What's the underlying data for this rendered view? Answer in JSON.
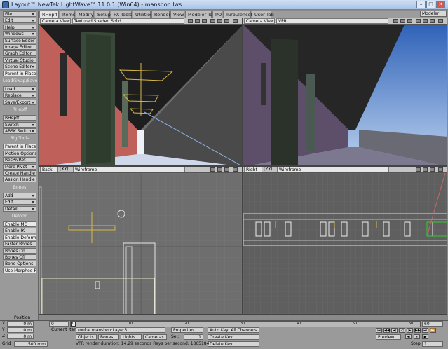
{
  "title": "Layout™ NewTek LightWave™ 11.0.1 (Win64) - manshon.lws",
  "tabs": [
    "RHepff",
    "Items",
    "Modify",
    "Setup",
    "FX Tools",
    "Utilities",
    "Render",
    "View",
    "Modeler Tools",
    "I/O",
    "TurbulenceFD",
    "User Tab"
  ],
  "modeler": "Modeler",
  "sidebar": {
    "items": [
      {
        "label": "File",
        "dd": true
      },
      {
        "label": "Edit",
        "dd": true
      },
      {
        "label": "Help",
        "dd": true
      },
      {
        "label": "Windows",
        "dd": true
      },
      {
        "label": "Surface Editor"
      },
      {
        "label": "Image Editor"
      },
      {
        "label": "Graph Editor"
      },
      {
        "label": "Virtual Studio"
      },
      {
        "label": "Scene Editor",
        "dd": true
      },
      {
        "label": "Parent in Place",
        "sel": true
      },
      {
        "head": "Load/Swap/Save"
      },
      {
        "label": "Load",
        "dd": true
      },
      {
        "label": "Replace",
        "dd": true
      },
      {
        "label": "Save/Export",
        "dd": true
      },
      {
        "head": "RHepff"
      },
      {
        "label": "RHepff"
      },
      {
        "label": "Switch",
        "dd": true
      },
      {
        "label": "ABSK Switch",
        "dd": true
      },
      {
        "head": "Rig Tools"
      },
      {
        "label": "Parent in Place",
        "sel": true
      },
      {
        "label": "Motion Options"
      },
      {
        "label": "RecPivRot"
      },
      {
        "label": "More Pivot",
        "dd": true
      },
      {
        "label": "Create Handle"
      },
      {
        "label": "Assign Handle"
      },
      {
        "head": "Bones"
      },
      {
        "label": "Add",
        "dd": true
      },
      {
        "label": "Edit",
        "dd": true
      },
      {
        "label": "Detail",
        "dd": true
      },
      {
        "head": "Deform"
      },
      {
        "label": "Enable MC",
        "sel": true
      },
      {
        "label": "Enable IK"
      },
      {
        "label": "Enable Deform",
        "sel": true
      },
      {
        "label": "Faster Bones"
      },
      {
        "label": "Bones On"
      },
      {
        "label": "Bones Off"
      },
      {
        "label": "Bone Options"
      },
      {
        "label": "Use Morphed Positions",
        "sel": true
      }
    ]
  },
  "viewports": {
    "tl": {
      "view": "Camera View",
      "mode": "Textured Shaded Solid"
    },
    "tr": {
      "view": "Camera View",
      "mode": "VPR"
    },
    "bl": {
      "view": "Back",
      "axes": "(XY)",
      "mode": "Wireframe"
    },
    "br": {
      "view": "Right",
      "axes": "(ZY)",
      "mode": "Wireframe"
    }
  },
  "bottom": {
    "position_label": "Position",
    "x_label": "X",
    "y_label": "Y",
    "z_label": "Z",
    "grid_label": "Grid",
    "x_value": "0 m",
    "y_value": "0 m",
    "z_value": "0 m",
    "grid_value": "500 mm",
    "frame_start": "0",
    "frame_end": "60",
    "ticks": [
      "0",
      "10",
      "20",
      "30",
      "40",
      "50",
      "60"
    ],
    "current_frame": "0",
    "current_item_label": "Current Item",
    "current_item": "rouka_manshon:Layer3",
    "properties": "Properties",
    "autokey": "Auto Key: All Channels",
    "objects": "Objects",
    "bones": "Bones",
    "lights": "Lights",
    "cameras": "Cameras",
    "sel_label": "Sel:",
    "sel_value": "1",
    "create_key": "Create Key",
    "delete_key": "Delete Key",
    "status": "VPR render duration: 14.29 seconds  Rays per second: 1865184",
    "preview": "Preview",
    "step_label": "Step",
    "step_value": "1"
  }
}
